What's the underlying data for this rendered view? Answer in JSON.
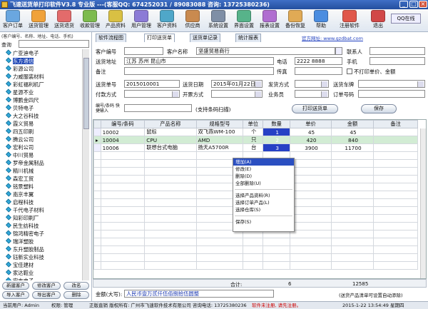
{
  "window": {
    "title": "飞速送货单打印软件V3.8 专业版 ---(客服QQ: 674252031 / 89083088 咨询: 13725380236)"
  },
  "toolbar": {
    "items": [
      {
        "label": "客户订单",
        "color": "#6aa7e0"
      },
      {
        "label": "送货管理",
        "color": "#f0a23a"
      },
      {
        "label": "送货退货",
        "color": "#e36b6b"
      },
      {
        "label": "收款管理",
        "color": "#7dbb4e"
      },
      {
        "label": "产品资料",
        "color": "#d9c043"
      },
      {
        "label": "用户管理",
        "color": "#8c7bd6"
      },
      {
        "label": "客户资料",
        "color": "#4fa7c9"
      },
      {
        "label": "供应商",
        "color": "#c98a4f"
      },
      {
        "label": "系统设置",
        "color": "#7f8fa6"
      },
      {
        "label": "界面设置",
        "color": "#57b38a"
      },
      {
        "label": "报表设置",
        "color": "#b06ed0"
      },
      {
        "label": "备份恢复",
        "color": "#e0aa55"
      },
      {
        "label": "帮助",
        "color": "#4b8de0"
      },
      {
        "label": "注册软件",
        "color": "#e0584b"
      },
      {
        "label": "退出",
        "color": "#d14848"
      }
    ],
    "qq_label": "QQ在线"
  },
  "left": {
    "hint": "(客户编号、名称、地址、电话、手机)",
    "search_label": "查询",
    "customers": [
      "广亚迪电子",
      "东方通信",
      "彩源公司",
      "力威服装材料",
      "彩虹福利机厂",
      "星源不业",
      "博鹏金四尺",
      "贝特电子",
      "大之谷科技",
      "霞义贸易",
      "四五印刷",
      "腾云公司",
      "宏利公司",
      "中川贸易",
      "罗帝金属制品",
      "精川机械",
      "森宏工贸",
      "铭景塑料",
      "南京丰翼",
      "启程科技",
      "千代电子材料",
      "知彩印刷厂",
      "民生纺科技",
      "锦鸿精密电子",
      "瑞洋塑胶",
      "东升塑胶制品",
      "钰新实业科技",
      "宝佳建材",
      "家达鞋业",
      "宏志电子"
    ],
    "selected_index": 1,
    "buttons": {
      "new": "新建客户",
      "edit": "修改客户",
      "modify": "改名",
      "import": "导入客户",
      "export": "导出客户",
      "delete": "删除"
    }
  },
  "tabs": [
    "软件流程图",
    "打印送货单",
    "送货单记录",
    "统计报表"
  ],
  "website": "官方网址: www.gzdbat.com",
  "form": {
    "customer_no_label": "客户编号",
    "customer_no": "",
    "customer_name_label": "客户名称",
    "customer_name": "坚盛贸易商行",
    "contact_label": "联系人",
    "contact": "",
    "address_label": "送货地址",
    "address": "江苏 苏州 昆山市",
    "phone_label": "电话",
    "phone": "2222 8888",
    "mobile_label": "手机",
    "mobile": "",
    "note_label": "备注",
    "note": "",
    "fax_label": "传真",
    "fax": "",
    "no_price_label": "不打印单价、金额",
    "order_no_label": "送货单号",
    "order_no": "2015010001",
    "date_label": "送货日期",
    "date": "2015年01月22日",
    "ship_method_label": "发货方式",
    "ship_method": "",
    "vehicle_label": "送货车牌",
    "vehicle": "",
    "pay_label": "付款方式",
    "pay": "",
    "invoice_label": "开票方式",
    "invoice": "",
    "salesman_label": "业务员",
    "salesman": "",
    "order_num_label": "订单号码",
    "order_num": "",
    "code_input_label": "编号/条码 快捷输入",
    "scan_hint": "(支持条码扫描)",
    "print_button": "打印送货单",
    "save_button": "保存"
  },
  "grid": {
    "columns": [
      "编号/条码",
      "产品名称",
      "规格型号",
      "单位",
      "数量",
      "单价",
      "金额",
      "备注"
    ],
    "rows": [
      {
        "code": "10002",
        "name": "鼠标",
        "spec": "双飞燕WM-100",
        "unit": "个",
        "qty": "1",
        "price": "45",
        "amount": "45",
        "note": ""
      },
      {
        "code": "10004",
        "name": "CPU",
        "spec": "AMD",
        "unit": "只",
        "qty": "2",
        "price": "420",
        "amount": "840",
        "note": ""
      },
      {
        "code": "10006",
        "name": "联想台式电脑",
        "spec": "扬天A5700R",
        "unit": "台",
        "qty": "3",
        "price": "3900",
        "amount": "11700",
        "note": ""
      }
    ],
    "total_label": "合计:",
    "total_qty": "6",
    "total_amount": "12585"
  },
  "amount_words_label": "金额(大写):",
  "amount_words": "人民币壹万贰仟伍佰捌拾伍圆整",
  "amount_hint": "(送货产品清单可设置自动添除)",
  "context_menu": [
    "增加(A)",
    "修改(E)",
    "删除(D)",
    "全部删除(U)",
    "选择产品资料(R)",
    "选择订单产品(L)",
    "选择仓库(S)",
    "保存(S)"
  ],
  "status": {
    "user": "当前用户: Admin",
    "perm": "权限: 管理",
    "company": "正版直销 版权所有: 广州市飞速软件技术有限公司 咨询电话: 13725380236",
    "unreg": "软件未注册, 请先注册。",
    "datetime": "2015-1-22 13:54:49 星期四"
  }
}
